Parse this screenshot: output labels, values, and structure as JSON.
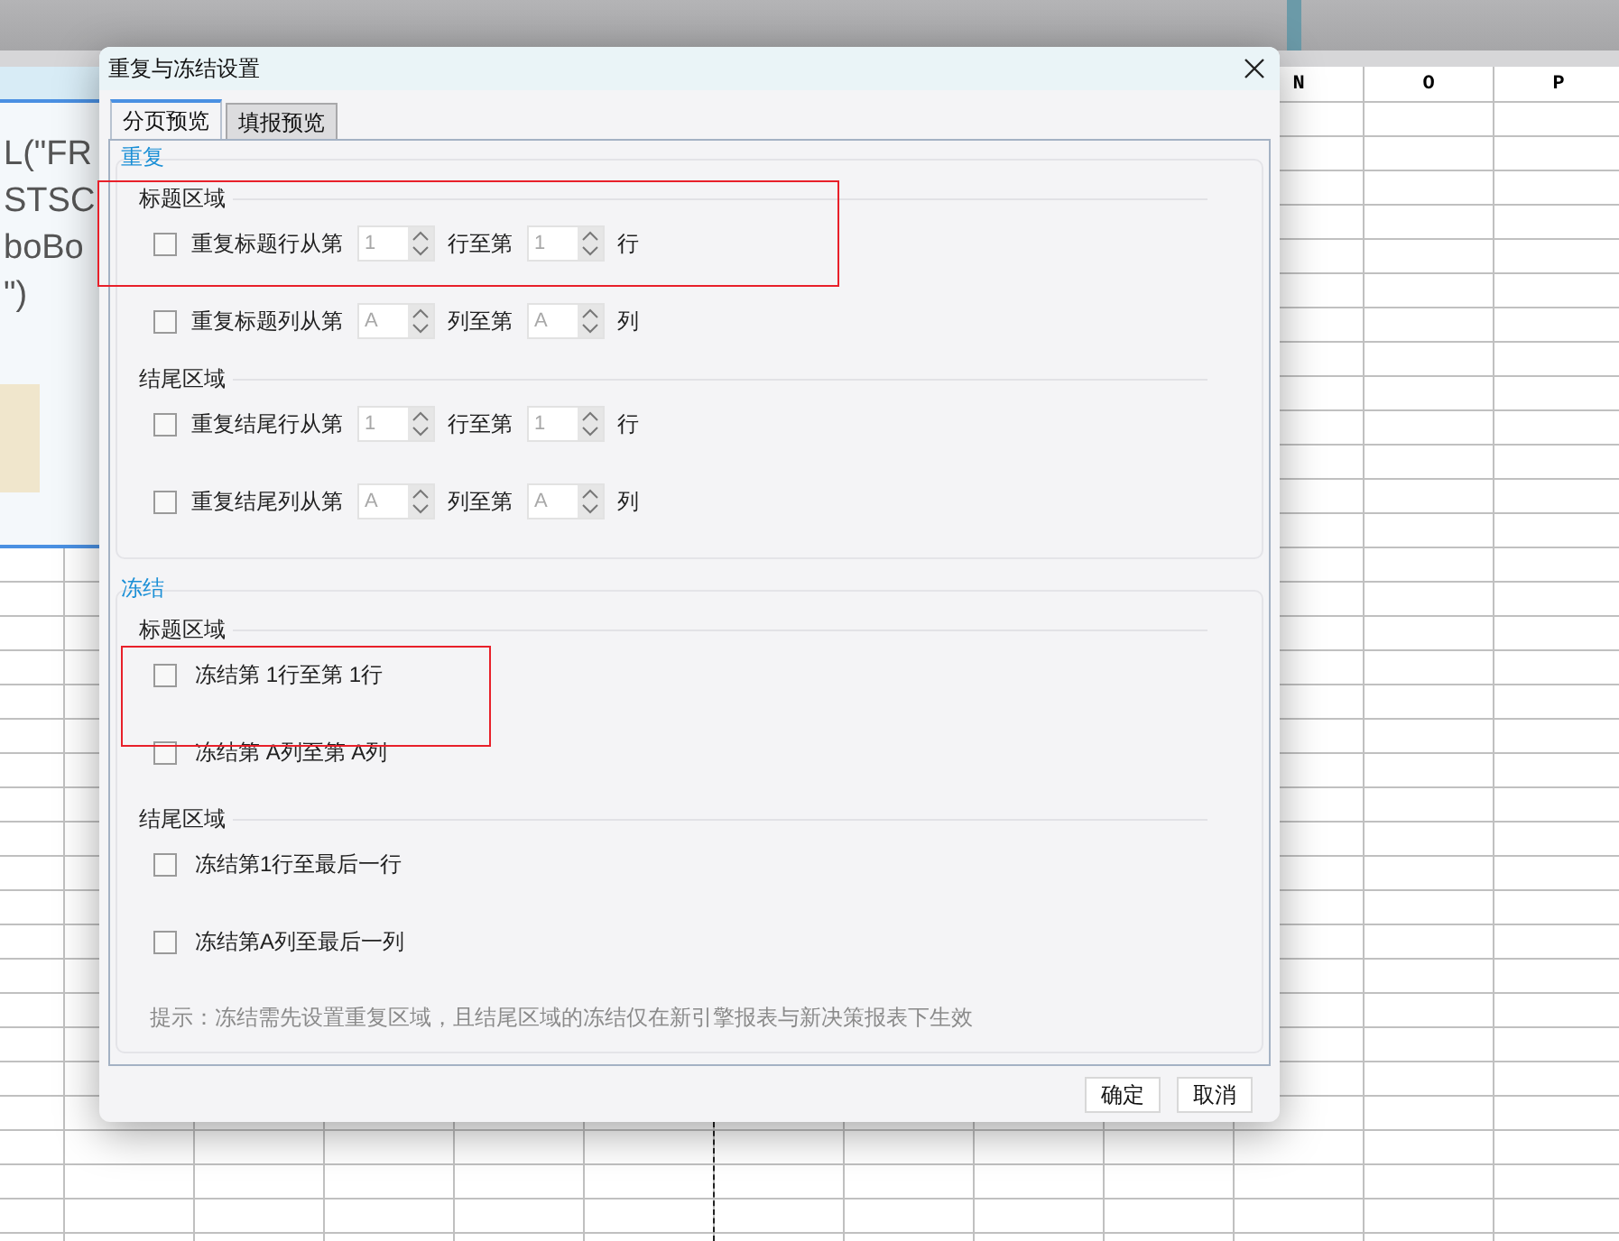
{
  "spreadsheet": {
    "columns": [
      "N",
      "O",
      "P"
    ],
    "side_panel": {
      "lines": [
        "L(\"FR",
        "STSC",
        "boBo",
        "\")"
      ]
    }
  },
  "dialog": {
    "title": "重复与冻结设置",
    "tabs": [
      {
        "label": "分页预览",
        "selected": true
      },
      {
        "label": "填报预览",
        "selected": false
      }
    ],
    "sections": [
      {
        "title": "重复",
        "groups": [
          {
            "title": "标题区域",
            "rows": [
              {
                "kind": "range",
                "checked": false,
                "label": "重复标题行从第",
                "from": "1",
                "middle": "行至第",
                "to": "1",
                "unit": "行"
              },
              {
                "kind": "range",
                "checked": false,
                "label": "重复标题列从第",
                "from": "A",
                "middle": "列至第",
                "to": "A",
                "unit": "列"
              }
            ]
          },
          {
            "title": "结尾区域",
            "rows": [
              {
                "kind": "range",
                "checked": false,
                "label": "重复结尾行从第",
                "from": "1",
                "middle": "行至第",
                "to": "1",
                "unit": "行"
              },
              {
                "kind": "range",
                "checked": false,
                "label": "重复结尾列从第",
                "from": "A",
                "middle": "列至第",
                "to": "A",
                "unit": "列"
              }
            ]
          }
        ]
      },
      {
        "title": "冻结",
        "groups": [
          {
            "title": "标题区域",
            "rows": [
              {
                "kind": "text",
                "checked": false,
                "label": "冻结第 1行至第 1行"
              },
              {
                "kind": "text",
                "checked": false,
                "label": "冻结第 A列至第 A列"
              }
            ]
          },
          {
            "title": "结尾区域",
            "rows": [
              {
                "kind": "text",
                "checked": false,
                "label": "冻结第1行至最后一行"
              },
              {
                "kind": "text",
                "checked": false,
                "label": "冻结第A列至最后一列"
              }
            ]
          }
        ],
        "hint": "提示：冻结需先设置重复区域，且结尾区域的冻结仅在新引擎报表与新决策报表下生效"
      }
    ],
    "buttons": [
      "确定",
      "取消"
    ]
  }
}
